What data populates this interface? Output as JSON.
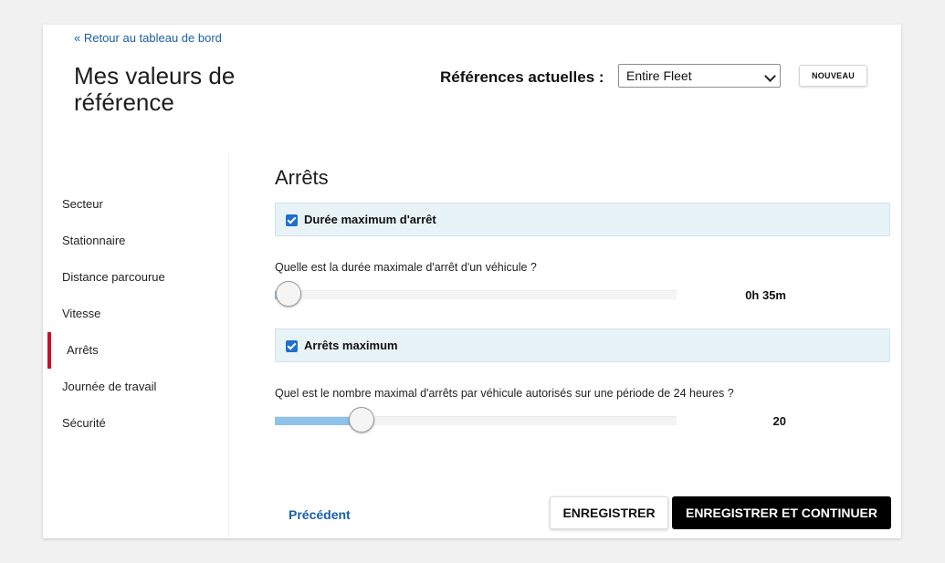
{
  "header": {
    "back_link": "« Retour au tableau de bord",
    "title": "Mes valeurs de référence",
    "refs_label": "Références actuelles :",
    "refs_selected": "Entire Fleet",
    "new_button": "NOUVEAU"
  },
  "sidebar": {
    "items": [
      {
        "label": "Secteur"
      },
      {
        "label": "Stationnaire"
      },
      {
        "label": "Distance parcourue"
      },
      {
        "label": "Vitesse"
      },
      {
        "label": "Arrêts",
        "active": true
      },
      {
        "label": "Journée de travail"
      },
      {
        "label": "Sécurité"
      }
    ]
  },
  "main": {
    "section_title": "Arrêts",
    "settings": [
      {
        "checkbox_label": "Durée maximum d'arrêt",
        "checked": true,
        "question": "Quelle est la durée maximale d'arrêt d'un véhicule ?",
        "value_label": "0h 35m",
        "slider_fraction": 0.035
      },
      {
        "checkbox_label": "Arrêts maximum",
        "checked": true,
        "question": "Quel est le nombre maximal d'arrêts par véhicule autorisés sur une période de 24 heures ?",
        "value_label": "20",
        "slider_fraction": 0.215
      }
    ]
  },
  "footer": {
    "prev_link": "Précédent",
    "save_button": "ENREGISTRER",
    "save_continue_button": "ENREGISTRER ET CONTINUER"
  },
  "colors": {
    "accent": "#c8102e",
    "link": "#1a5fa8",
    "checkbox": "#1f6fd0",
    "panel_bg": "#e8f3f8",
    "slider_fill": "#8ec2ea"
  },
  "icons": {
    "select_chevron": "chevron-down-icon",
    "checkbox": "checkmark-icon"
  }
}
